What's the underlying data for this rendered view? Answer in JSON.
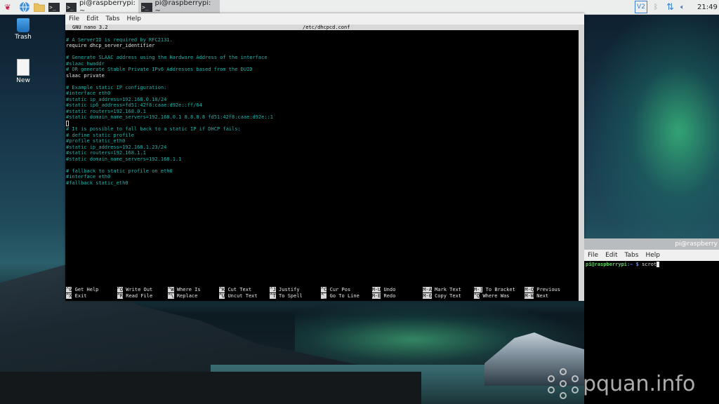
{
  "panel": {
    "tasks": [
      {
        "label": "pi@raspberrypi: ~"
      },
      {
        "label": "pi@raspberrypi: ~"
      }
    ],
    "clock": "21:49"
  },
  "desktop": {
    "icons": [
      {
        "label": "Trash"
      },
      {
        "label": "New"
      }
    ]
  },
  "editor_window": {
    "menu": [
      "File",
      "Edit",
      "Tabs",
      "Help"
    ],
    "nano_version": "GNU nano 3.2",
    "filename": "/etc/dhcpcd.conf",
    "lines": [
      "",
      "# A ServerID is required by RFC2131.",
      "require dhcp_server_identifier",
      "",
      "# Generate SLAAC address using the Hardware Address of the interface",
      "#slaac hwaddr",
      "# OR generate Stable Private IPv6 Addresses based from the DUID",
      "slaac private",
      "",
      "# Example static IP configuration:",
      "#interface eth0",
      "#static ip_address=192.168.0.10/24",
      "#static ip6_address=fd51:42f8:caae:d92e::ff/64",
      "#static routers=192.168.0.1",
      "#static domain_name_servers=192.168.0.1 8.8.8.8 fd51:42f8:caae:d92e::1",
      "",
      "# It is possible to fall back to a static IP if DHCP fails:",
      "# define static profile",
      "#profile static_eth0",
      "#static ip_address=192.168.1.23/24",
      "#static routers=192.168.1.1",
      "#static domain_name_servers=192.168.1.1",
      "",
      "# fallback to static profile on eth0",
      "#interface eth0",
      "#fallback static_eth0"
    ],
    "white_lines": [
      2,
      7
    ],
    "cursor_line": 15,
    "shortcuts_row1": [
      {
        "key": "^G",
        "label": "Get Help"
      },
      {
        "key": "^O",
        "label": "Write Out"
      },
      {
        "key": "^W",
        "label": "Where Is"
      },
      {
        "key": "^K",
        "label": "Cut Text"
      },
      {
        "key": "^J",
        "label": "Justify"
      },
      {
        "key": "^C",
        "label": "Cur Pos"
      },
      {
        "key": "M-U",
        "label": "Undo"
      },
      {
        "key": "M-A",
        "label": "Mark Text"
      },
      {
        "key": "M-]",
        "label": "To Bracket"
      },
      {
        "key": "M-Q",
        "label": "Previous"
      }
    ],
    "shortcuts_row2": [
      {
        "key": "^X",
        "label": "Exit"
      },
      {
        "key": "^R",
        "label": "Read File"
      },
      {
        "key": "^\\",
        "label": "Replace"
      },
      {
        "key": "^U",
        "label": "Uncut Text"
      },
      {
        "key": "^T",
        "label": "To Spell"
      },
      {
        "key": "^_",
        "label": "Go To Line"
      },
      {
        "key": "M-E",
        "label": "Redo"
      },
      {
        "key": "M-6",
        "label": "Copy Text"
      },
      {
        "key": "^Q",
        "label": "Where Was"
      },
      {
        "key": "M-W",
        "label": "Next"
      }
    ]
  },
  "shell_window": {
    "title": "pi@raspberry",
    "menu": [
      "File",
      "Edit",
      "Tabs",
      "Help"
    ],
    "prompt_user": "pi@raspberrypi",
    "prompt_path": ":~ $",
    "command": " scrot"
  },
  "watermark": "pquan.info",
  "icons": {
    "menu": "raspberry-icon",
    "browser": "globe-icon",
    "files": "folder-icon",
    "terminal": "terminal-icon",
    "vnc": "vnc-icon",
    "bluetooth": "bluetooth-icon",
    "network": "network-arrows-icon",
    "volume": "speaker-icon"
  },
  "colors": {
    "nano_text": "#20b2aa",
    "prompt_green": "#5fd35f",
    "prompt_blue": "#6f8ff0"
  }
}
